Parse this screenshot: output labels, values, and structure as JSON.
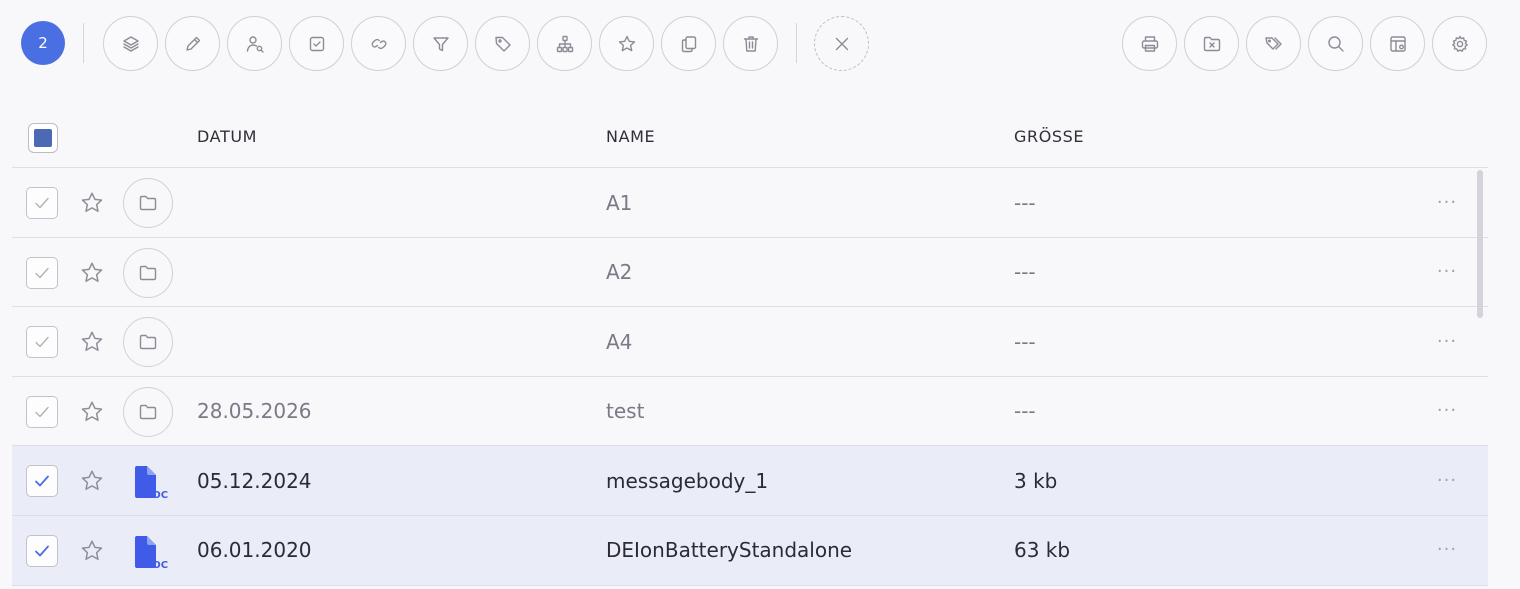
{
  "toolbar": {
    "selected_count": "2",
    "left_icons": [
      "layers-icon",
      "pencil-icon",
      "user-key-icon",
      "checkbox-icon",
      "link-icon",
      "filter-icon",
      "tag-icon",
      "hierarchy-icon",
      "star-icon",
      "copy-icon",
      "trash-icon"
    ],
    "close_icon": "close-icon",
    "right_icons": [
      "print-icon",
      "folder-remove-icon",
      "tags-icon",
      "search-icon",
      "table-settings-icon",
      "gear-icon"
    ]
  },
  "table": {
    "columns": {
      "date": "DATUM",
      "name": "NAME",
      "size": "GRÖSSE"
    },
    "rows": [
      {
        "type": "folder",
        "date": "",
        "name": "A1",
        "size": "---",
        "checked": false
      },
      {
        "type": "folder",
        "date": "",
        "name": "A2",
        "size": "---",
        "checked": false
      },
      {
        "type": "folder",
        "date": "",
        "name": "A4",
        "size": "---",
        "checked": false
      },
      {
        "type": "folder",
        "date": "28.05.2026",
        "name": "test",
        "size": "---",
        "checked": false
      },
      {
        "type": "doc",
        "date": "05.12.2024",
        "name": "messagebody_1",
        "size": "3 kb",
        "checked": true
      },
      {
        "type": "doc",
        "date": "06.01.2020",
        "name": "DEIonBatteryStandalone",
        "size": "63 kb",
        "checked": true
      }
    ],
    "more_label": "···",
    "doc_badge": "DOC"
  },
  "colors": {
    "accent": "#4a6fe3",
    "selected_row": "#eaedf8",
    "doc_icon": "#3f5be8"
  }
}
